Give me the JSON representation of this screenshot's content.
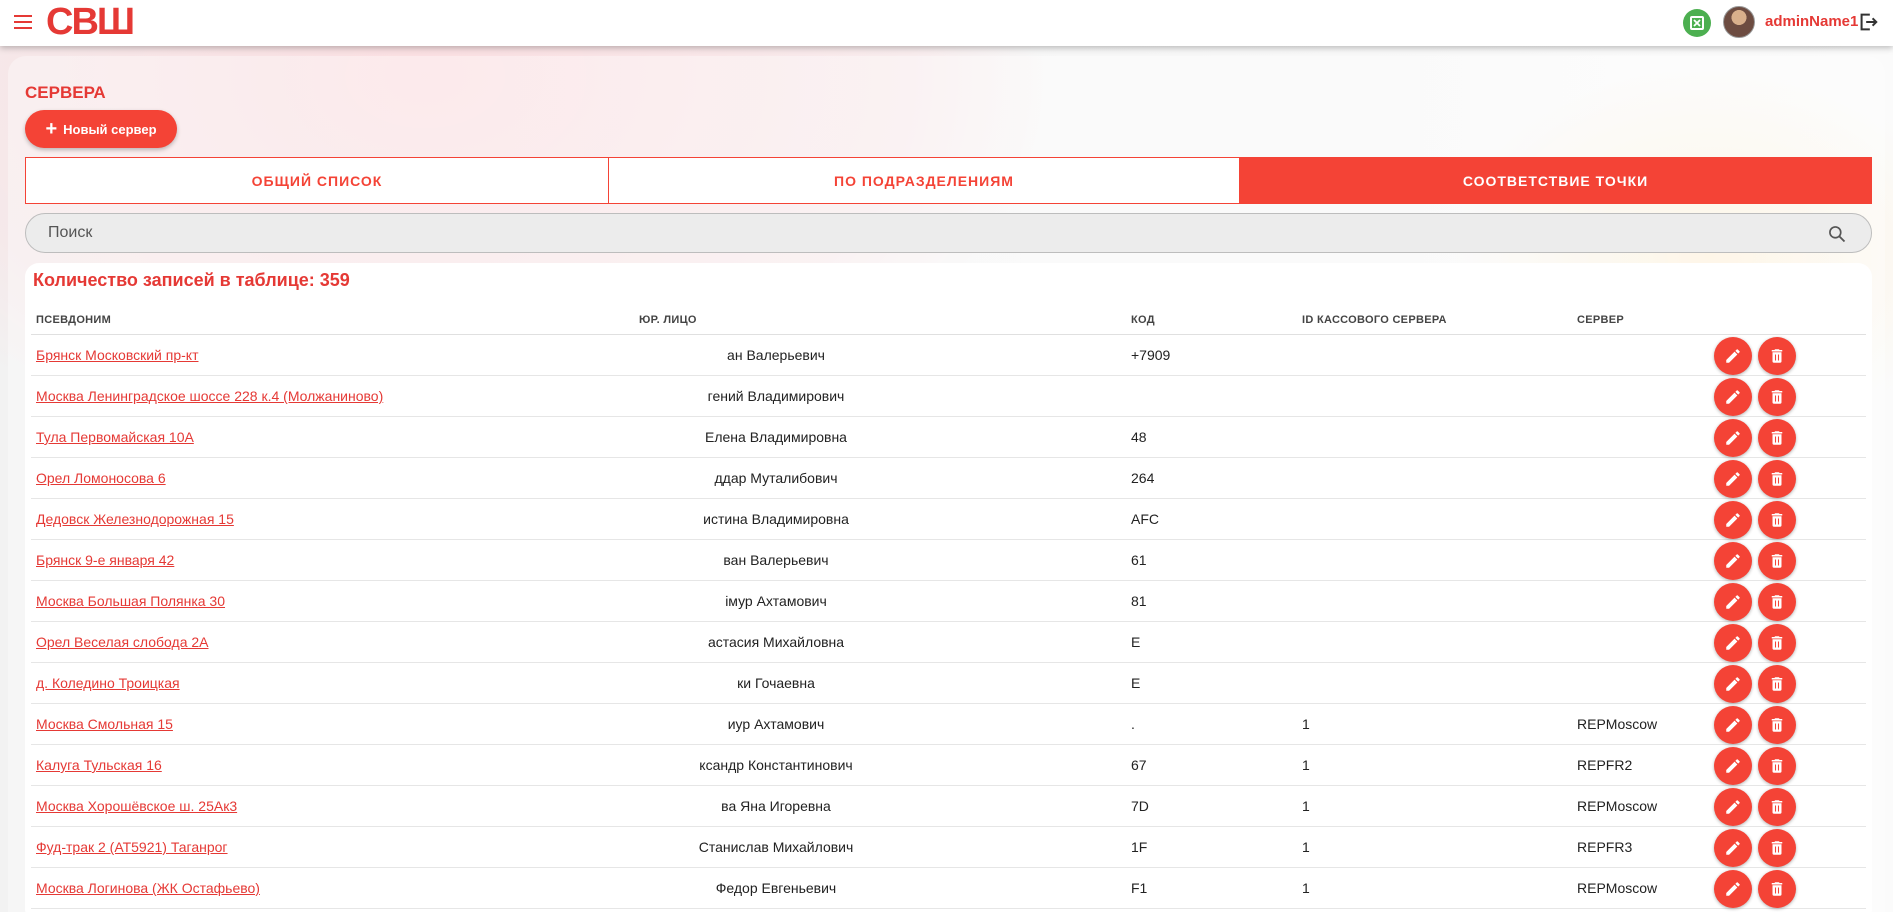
{
  "header": {
    "logo": "СВШ",
    "username": "adminName1",
    "icons": [
      "menu-icon",
      "excel-icon",
      "avatar",
      "logout-icon"
    ]
  },
  "page": {
    "title": "СЕРВЕРА",
    "new_button_label": "Новый сервер"
  },
  "tabs": [
    {
      "label": "ОБЩИЙ СПИСОК",
      "active": false
    },
    {
      "label": "ПО ПОДРАЗДЕЛЕНИЯМ",
      "active": false
    },
    {
      "label": "СООТВЕТСТВИЕ ТОЧКИ",
      "active": true
    }
  ],
  "search": {
    "placeholder": "Поиск",
    "value": ""
  },
  "table": {
    "count_label": "Количество записей в таблице: 359",
    "columns": [
      "ПСЕВДОНИМ",
      "ЮР. ЛИЦО",
      "КОД",
      "ID КАССОВОГО СЕРВЕРА",
      "СЕРВЕР"
    ],
    "rows": [
      {
        "alias": "Брянск Московский пр-кт",
        "legal": "ан Валерьевич",
        "code": "+7909",
        "kid": "",
        "server": ""
      },
      {
        "alias": "Москва Ленинградское шоссе 228 к.4 (Молжаниново)",
        "legal": "гений Владимирович",
        "code": "",
        "kid": "",
        "server": ""
      },
      {
        "alias": "Тула Первомайская 10А",
        "legal": "Елена Владимировна",
        "code": "48",
        "kid": "",
        "server": ""
      },
      {
        "alias": "Орел Ломоносова 6",
        "legal": "ддар Муталибович",
        "code": "264",
        "kid": "",
        "server": ""
      },
      {
        "alias": "Дедовск Железнодорожная 15",
        "legal": "истина Владимировна",
        "code": "AFC",
        "kid": "",
        "server": ""
      },
      {
        "alias": "Брянск 9-е января 42",
        "legal": "ван Валерьевич",
        "code": "61",
        "kid": "",
        "server": ""
      },
      {
        "alias": "Москва Большая Полянка 30",
        "legal": "імур Ахтамович",
        "code": "81",
        "kid": "",
        "server": ""
      },
      {
        "alias": "Орел Веселая слобода 2А",
        "legal": "астасия Михайловна",
        "code": "E",
        "kid": "",
        "server": ""
      },
      {
        "alias": "д. Коледино Троицкая",
        "legal": "ки Гочаевна",
        "code": "E",
        "kid": "",
        "server": ""
      },
      {
        "alias": "Москва Смольная 15",
        "legal": "иур Ахтамович",
        "code": ".",
        "kid": "1",
        "server": "REPMoscow"
      },
      {
        "alias": "Калуга Тульская 16",
        "legal": "ксандр Константинович",
        "code": "67",
        "kid": "1",
        "server": "REPFR2"
      },
      {
        "alias": "Москва Хорошёвское ш. 25Ак3",
        "legal": "ва Яна Игоревна",
        "code": "7D",
        "kid": "1",
        "server": "REPMoscow"
      },
      {
        "alias": "Фуд-трак 2 (АТ5921) Таганрог",
        "legal": "Станислав Михайлович",
        "code": "1F",
        "kid": "1",
        "server": "REPFR3"
      },
      {
        "alias": "Москва Логинова (ЖК Остафьево)",
        "legal": "Федор Евгеньевич",
        "code": "F1",
        "kid": "1",
        "server": "REPMoscow"
      }
    ]
  },
  "colors": {
    "accent": "#f44336",
    "brand": "#e53935"
  }
}
